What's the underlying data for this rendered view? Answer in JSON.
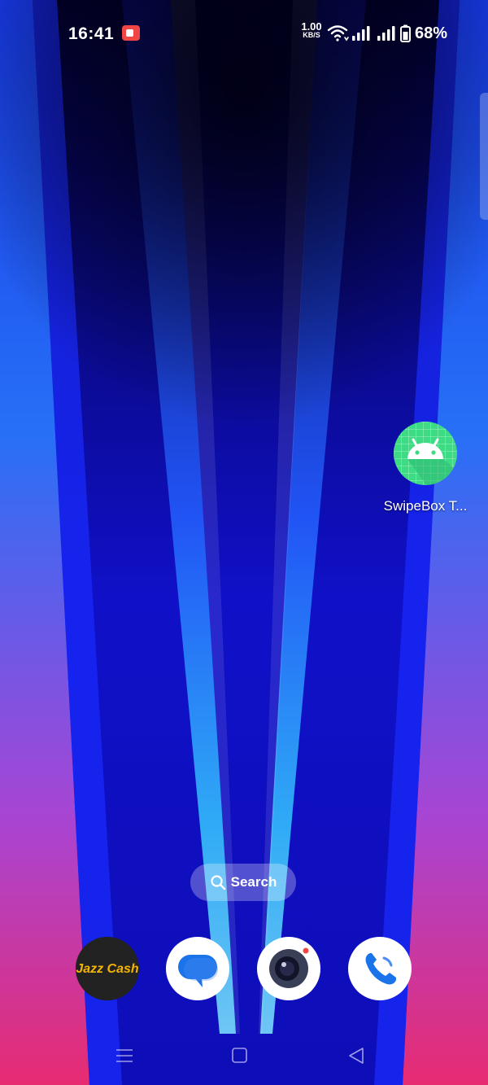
{
  "status_bar": {
    "time": "16:41",
    "net_speed_value": "1.00",
    "net_speed_unit": "KB/S",
    "battery_percent": "68%"
  },
  "home": {
    "apps": [
      {
        "label": "SwipeBox T...",
        "icon": "android-icon"
      }
    ],
    "search": {
      "label": "Search",
      "icon": "search-icon"
    }
  },
  "dock": [
    {
      "name": "JazzCash",
      "icon": "jazzcash-icon",
      "text": "Jazz Cash"
    },
    {
      "name": "Messages",
      "icon": "messages-icon"
    },
    {
      "name": "Camera",
      "icon": "camera-icon"
    },
    {
      "name": "Phone",
      "icon": "phone-icon"
    }
  ],
  "nav_bar": [
    "recents-icon",
    "home-icon",
    "back-icon"
  ],
  "colors": {
    "android_green": "#3ddc84",
    "jazz_yellow": "#f5b400",
    "messages_blue": "#1a73e8",
    "phone_blue": "#1a73e8",
    "record_red": "#f04646"
  }
}
